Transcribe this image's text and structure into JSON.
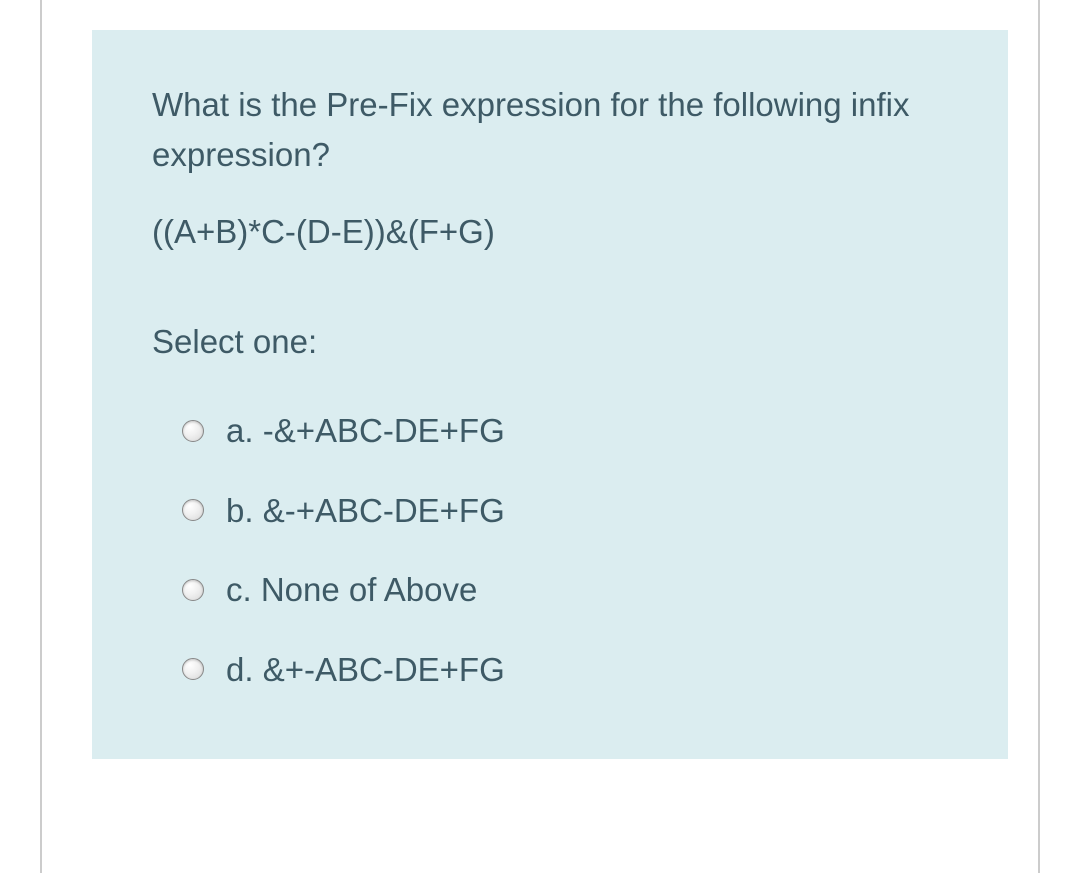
{
  "question": {
    "prompt": "What is the Pre-Fix expression for the following infix expression?",
    "expression": "((A+B)*C-(D-E))&(F+G)",
    "select_label": "Select one:",
    "options": [
      {
        "letter": "a.",
        "text": "-&+ABC-DE+FG"
      },
      {
        "letter": "b.",
        "text": "&-+ABC-DE+FG"
      },
      {
        "letter": "c.",
        "text": "None of Above"
      },
      {
        "letter": "d.",
        "text": "&+-ABC-DE+FG"
      }
    ]
  }
}
